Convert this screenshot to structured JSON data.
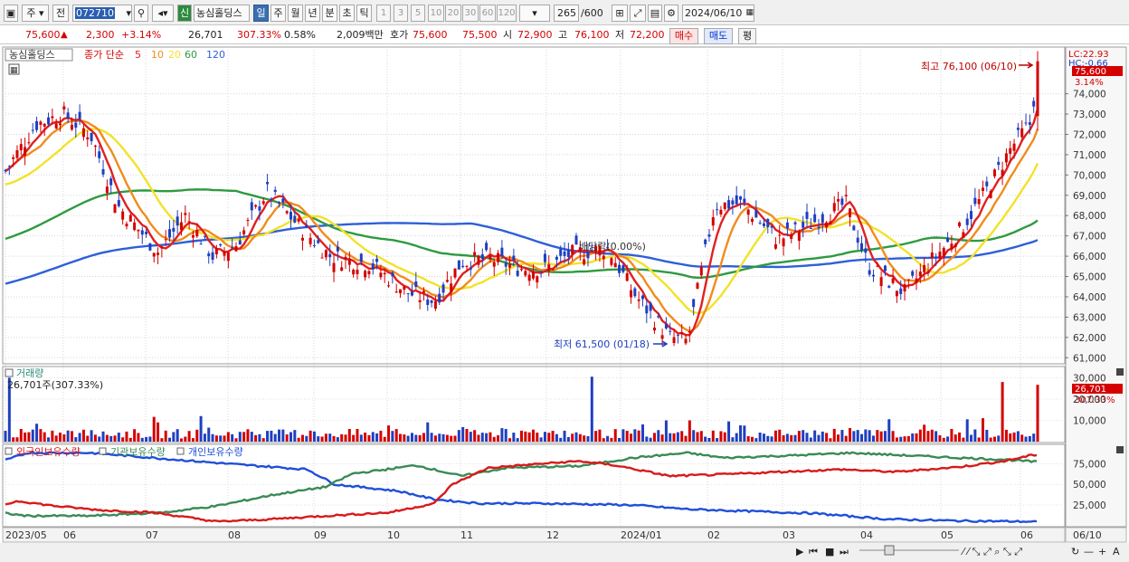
{
  "toolbar": {
    "market": "주",
    "prev": "전",
    "code": "072710",
    "stock_name": "농심홀딩스",
    "active_chart": "신",
    "periods": [
      "일",
      "주",
      "월",
      "년",
      "분",
      "초",
      "틱"
    ],
    "intervals": [
      "1",
      "3",
      "5",
      "10",
      "20",
      "30",
      "60",
      "120"
    ],
    "count": "265",
    "count_total": "/600",
    "date": "2024/06/10"
  },
  "quote": {
    "price": "75,600",
    "arrow": "▲",
    "change": "2,300",
    "change_pct": "+3.14%",
    "volume": "26,701",
    "volume_pct": "307.33%",
    "turnover": "0.58%",
    "amount": "2,009백만",
    "ask_label": "호가",
    "ask": "75,600",
    "bid": "75,500",
    "open_label": "시",
    "open": "72,900",
    "high_label": "고",
    "high": "76,100",
    "low_label": "저",
    "low": "72,200",
    "buy": "매수",
    "sell": "매도",
    "avg": "평"
  },
  "legend": {
    "name": "농심홀딩스",
    "ma_label": "종가 단순",
    "ma": [
      "5",
      "10",
      "20",
      "60",
      "120"
    ]
  },
  "price_axis": {
    "ticks": [
      "74,000",
      "73,000",
      "72,000",
      "71,000",
      "70,000",
      "69,000",
      "68,000",
      "67,000",
      "66,000",
      "65,000",
      "64,000",
      "63,000",
      "62,000",
      "61,000"
    ],
    "lc": "LC:22.93",
    "hc": "HC:-0.66",
    "last": "75,600",
    "last_pct": "3.14%"
  },
  "annotations": {
    "high": "최고 76,100 (06/10)",
    "low": "최저 61,500 (01/18)",
    "dividend": "배당락(0.00%)"
  },
  "volume_panel": {
    "title": "거래량",
    "value": "26,701주(307.33%)",
    "ticks": [
      "30,000",
      "20,000",
      "10,000"
    ],
    "last": "26,701",
    "last_pct": "307.33%"
  },
  "holder_panel": {
    "legends": [
      "외국인보유수량",
      "기관보유수량",
      "개인보유수량"
    ],
    "ticks": [
      "75,000",
      "50,000",
      "25,000"
    ]
  },
  "xaxis": {
    "labels": [
      "2023/05",
      "06",
      "07",
      "08",
      "09",
      "10",
      "11",
      "12",
      "2024/01",
      "02",
      "03",
      "04",
      "05",
      "06"
    ],
    "right_label": "06/10"
  },
  "colors": {
    "up": "#d40000",
    "down": "#1f3fbf",
    "ma5": "#e02020",
    "ma10": "#f08c1c",
    "ma20": "#f2e22a",
    "ma60": "#2e9a3f",
    "ma120": "#2f5fd8",
    "foreign": "#d81a1a",
    "inst": "#3a8a56",
    "indiv": "#1f4fd8"
  },
  "chart_data": {
    "type": "candlestick",
    "stock": "농심홀딩스",
    "period": "daily",
    "x_range": [
      "2023/05",
      "2024/06/10"
    ],
    "ylim": [
      61000,
      76100
    ],
    "ohlc_summary": {
      "last_close": 75600,
      "high": 76100,
      "high_date": "06/10",
      "low": 61500,
      "low_date": "01/18"
    },
    "ma_approx_end": {
      "5": 72500,
      "10": 71800,
      "20": 70200,
      "60": 67800,
      "120": 66700
    },
    "close_approx": [
      {
        "x": "2023/05",
        "y": 70500
      },
      {
        "x": "06",
        "y": 72800
      },
      {
        "x": "07",
        "y": 67000
      },
      {
        "x": "08",
        "y": 66500
      },
      {
        "x": "09",
        "y": 67000
      },
      {
        "x": "10",
        "y": 64000
      },
      {
        "x": "11",
        "y": 65400
      },
      {
        "x": "12",
        "y": 65700
      },
      {
        "x": "2024/01",
        "y": 62000
      },
      {
        "x": "02",
        "y": 68000
      },
      {
        "x": "03",
        "y": 67700
      },
      {
        "x": "04",
        "y": 64200
      },
      {
        "x": "05",
        "y": 67000
      },
      {
        "x": "06",
        "y": 75600
      }
    ],
    "volume_last": 26701
  }
}
